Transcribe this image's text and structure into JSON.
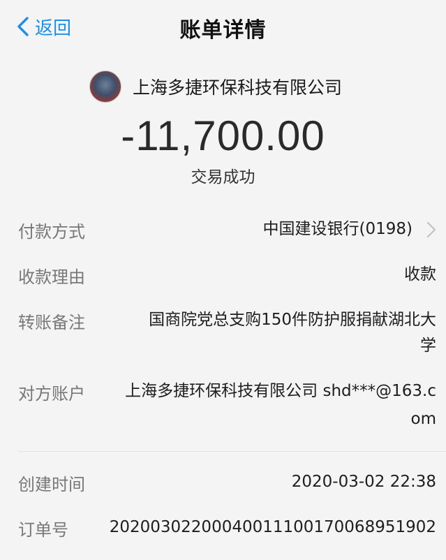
{
  "nav": {
    "back_label": "返回",
    "title": "账单详情"
  },
  "header": {
    "payee_name": "上海多捷环保科技有限公司",
    "amount": "-11,700.00",
    "status": "交易成功"
  },
  "details": {
    "payment_method_label": "付款方式",
    "payment_method_value": "中国建设银行(0198)",
    "reason_label": "收款理由",
    "reason_value": "收款",
    "note_label": "转账备注",
    "note_value_line1": "国商院党总支购150件防护服捐献湖北大",
    "note_value_line2": "学",
    "counterparty_label": "对方账户",
    "counterparty_value_line1": "上海多捷环保科技有限公司 shd***@163.c",
    "counterparty_value_line2": "om",
    "created_label": "创建时间",
    "created_value": "2020-03-02 22:38",
    "order_label": "订单号",
    "order_value": "20200302200040011100170068951902"
  },
  "colors": {
    "accent": "#1e8fe8",
    "background": "#f4f4f4",
    "label": "#777777",
    "value": "#1e1e1e"
  },
  "icons": {
    "back": "chevron-left-icon",
    "payment_method": "chevron-right-icon"
  }
}
